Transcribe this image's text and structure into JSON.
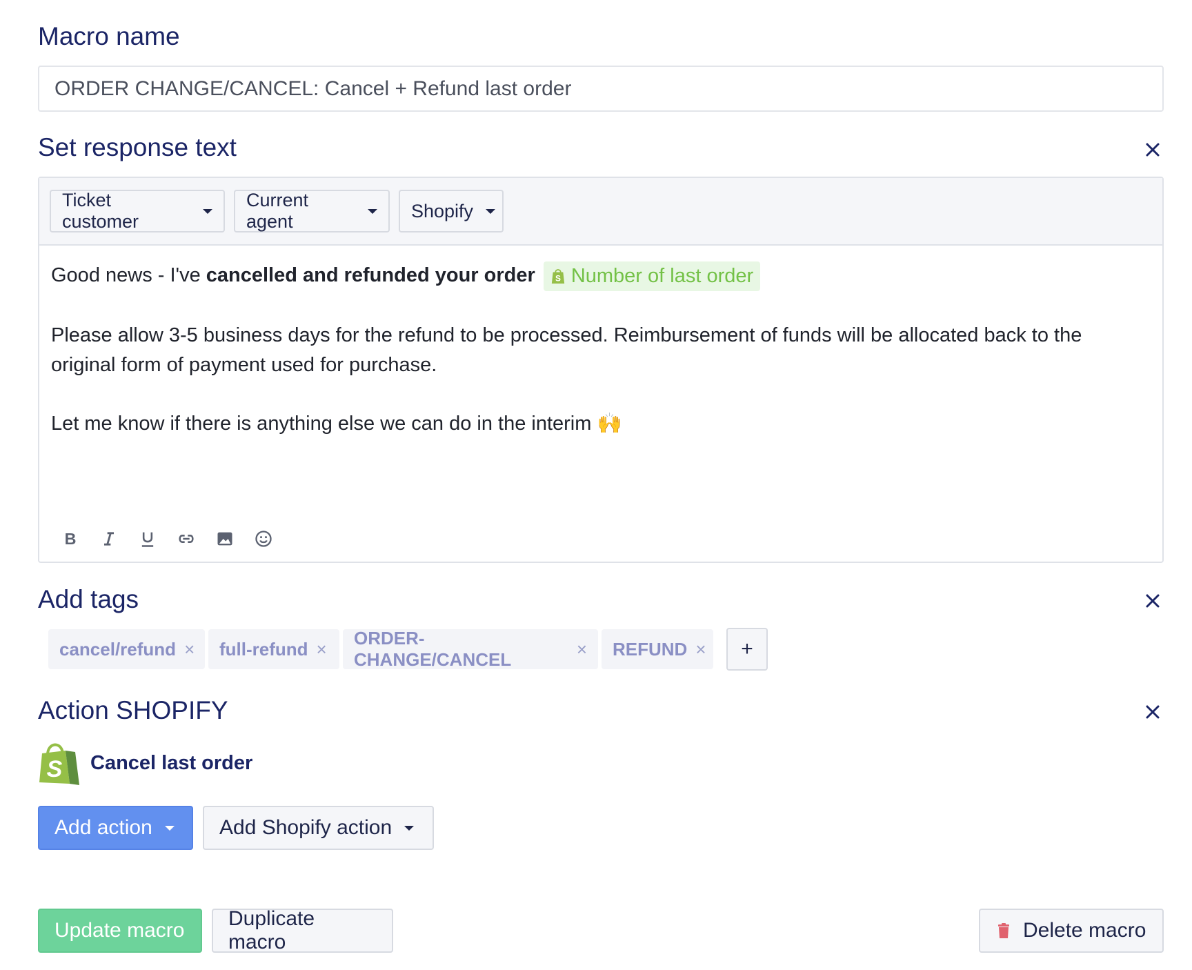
{
  "macro_name": {
    "label": "Macro name",
    "value": "ORDER CHANGE/CANCEL: Cancel + Refund last order"
  },
  "response": {
    "label": "Set response text",
    "variable_buttons": [
      "Ticket customer",
      "Current agent",
      "Shopify"
    ],
    "line1_prefix": "Good news - I've ",
    "line1_bold": "cancelled and refunded your order",
    "variable_pill": "Number of last order",
    "paragraph2": "Please allow 3-5 business days for the refund to be processed. Reimbursement of funds will be allocated back to the original form of payment used for purchase.",
    "paragraph3": "Let me know if there is anything else we can do in the interim",
    "paragraph3_emoji": "🙌",
    "format_tools": [
      "bold-icon",
      "italic-icon",
      "underline-icon",
      "link-icon",
      "image-icon",
      "emoji-icon"
    ]
  },
  "tags": {
    "label": "Add tags",
    "items": [
      "cancel/refund",
      "full-refund",
      "ORDER-CHANGE/CANCEL",
      "REFUND"
    ],
    "remove_glyph": "×",
    "add_glyph": "+"
  },
  "action": {
    "label": "Action SHOPIFY",
    "item_label": "Cancel last order",
    "add_action_label": "Add action",
    "add_shopify_action_label": "Add Shopify action"
  },
  "footer": {
    "update_label": "Update macro",
    "duplicate_label": "Duplicate macro",
    "delete_label": "Delete macro"
  },
  "colors": {
    "heading": "#1b2566",
    "primary": "#6290ef",
    "success": "#6dd39b",
    "shopify_green": "#95bf47",
    "tag_text": "#8a8fc4",
    "danger": "#e0626e"
  }
}
